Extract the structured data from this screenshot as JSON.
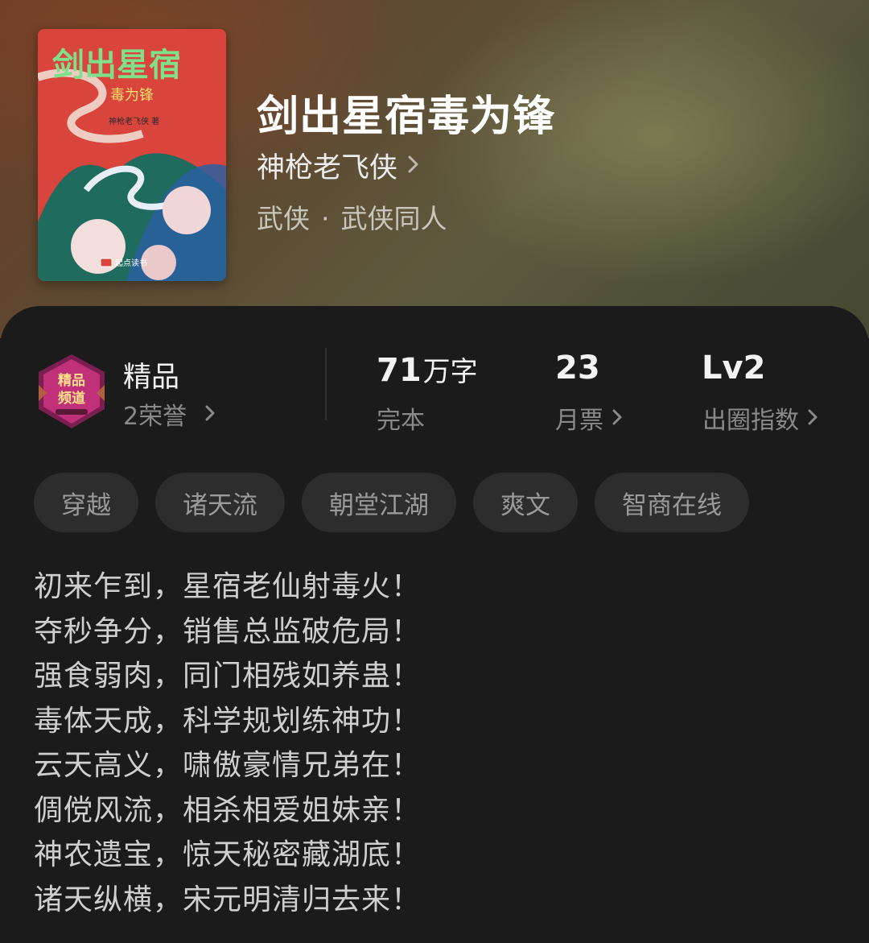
{
  "book": {
    "title": "剑出星宿毒为锋",
    "author": "神枪老飞侠",
    "genre_primary": "武侠",
    "genre_separator": "·",
    "genre_secondary": "武侠同人"
  },
  "cover": {
    "title_text": "剑出星宿",
    "subtitle_text": "毒为锋",
    "author_text": "神枪老飞侠 著",
    "publisher_text": "起点读书",
    "colors": {
      "background": "#d9443c",
      "title": "#7fe08a",
      "mountain": "#1f6b5e"
    }
  },
  "stats": {
    "channel": {
      "label": "精品",
      "honor": "2荣誉",
      "badge_text_line1": "精品",
      "badge_text_line2": "频道"
    },
    "words": {
      "value": "71",
      "unit": "万字",
      "label": "完本"
    },
    "monthly_votes": {
      "value": "23",
      "label": "月票"
    },
    "breakout": {
      "value": "Lv2",
      "label": "出圈指数"
    }
  },
  "tags": [
    "穿越",
    "诸天流",
    "朝堂江湖",
    "爽文",
    "智商在线"
  ],
  "synopsis": [
    "初来乍到，星宿老仙射毒火！",
    "夺秒争分，销售总监破危局！",
    "强食弱肉，同门相残如养蛊！",
    "毒体天成，科学规划练神功！",
    "云天高义，啸傲豪情兄弟在！",
    "倜傥风流，相杀相爱姐妹亲！",
    "神农遗宝，惊天秘密藏湖底！",
    "诸天纵横，宋元明清归去来！"
  ],
  "icons": {
    "chevron": "chevron-right-icon",
    "badge": "premium-channel-badge-icon"
  }
}
